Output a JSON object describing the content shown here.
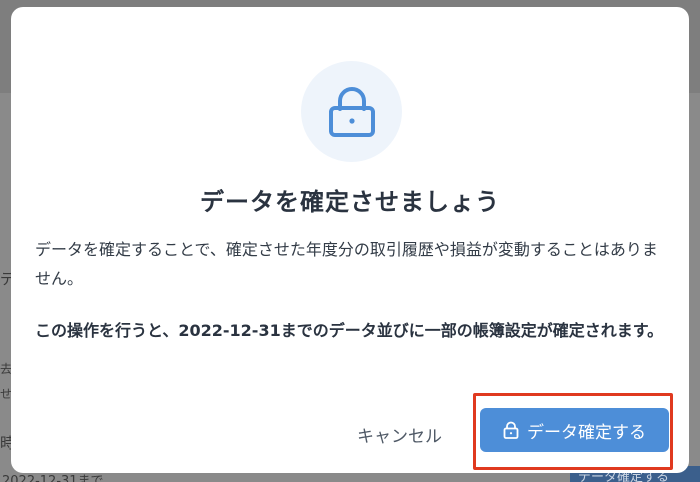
{
  "background": {
    "partial_texts": [
      "デ",
      "去",
      "せ",
      "時",
      "2022-12-31まで"
    ],
    "button_fragment": "データ確定する"
  },
  "dialog": {
    "icon": "lock-icon",
    "title": "データを確定させましょう",
    "description": "データを確定することで、確定させた年度分の取引履歴や損益が変動することはありません。",
    "notice": "この操作を行うと、2022-12-31までのデータ並びに一部の帳簿設定が確定されます。",
    "cancel_label": "キャンセル",
    "confirm_label": "データ確定する",
    "confirm_icon": "lock-icon"
  },
  "colors": {
    "accent": "#4d8ed8",
    "highlight": "#e0391f",
    "icon_bg": "#eef4fb"
  }
}
